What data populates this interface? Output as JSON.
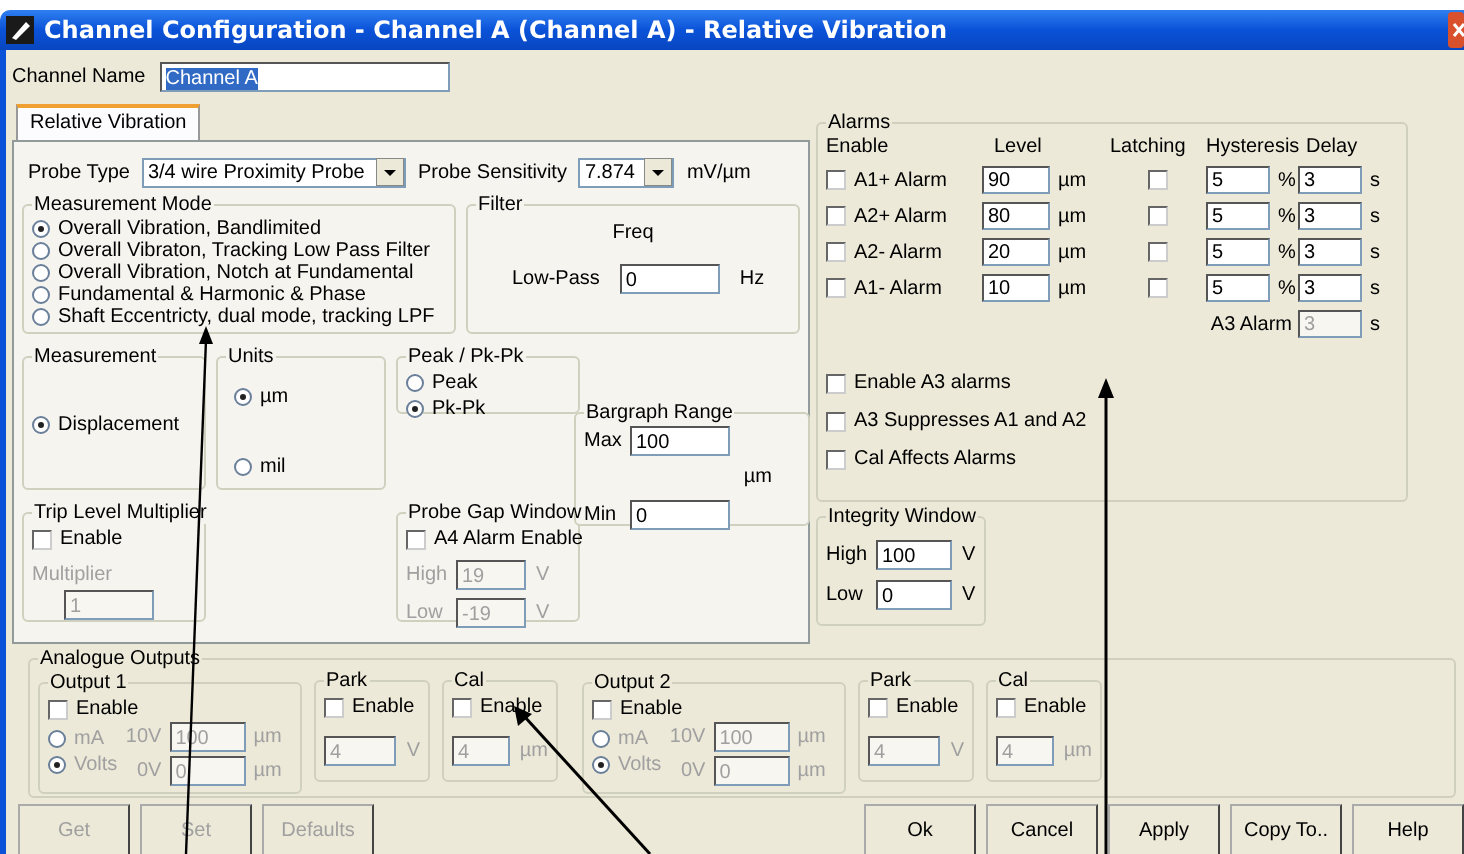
{
  "window": {
    "title": "Channel Configuration - Channel A (Channel A) - Relative Vibration"
  },
  "channel_name": {
    "label": "Channel Name",
    "value": "Channel A",
    "highlighted": true
  },
  "tabs": [
    {
      "label": "Relative Vibration",
      "selected": true
    }
  ],
  "probe_type": {
    "label": "Probe Type",
    "value": "3/4 wire Proximity Probe"
  },
  "probe_sensitivity": {
    "label": "Probe Sensitivity",
    "value": "7.874",
    "unit": "mV/µm"
  },
  "measurement_mode": {
    "title": "Measurement Mode",
    "options": [
      {
        "label": "Overall Vibration, Bandlimited",
        "selected": true
      },
      {
        "label": "Overall Vibraton, Tracking Low Pass Filter",
        "selected": false
      },
      {
        "label": "Overall Vibration, Notch at Fundamental",
        "selected": false
      },
      {
        "label": "Fundamental & Harmonic & Phase",
        "selected": false
      },
      {
        "label": "Shaft Eccentricty, dual mode, tracking LPF",
        "selected": false
      }
    ]
  },
  "filter": {
    "title": "Filter",
    "header": "Freq",
    "label": "Low-Pass",
    "value": "0",
    "unit": "Hz"
  },
  "measurement": {
    "title": "Measurement",
    "options": [
      {
        "label": "Displacement",
        "selected": true
      }
    ]
  },
  "units": {
    "title": "Units",
    "options": [
      {
        "label": "µm",
        "selected": true
      },
      {
        "label": "mil",
        "selected": false
      }
    ]
  },
  "peak": {
    "title": "Peak / Pk-Pk",
    "options": [
      {
        "label": "Peak",
        "selected": false
      },
      {
        "label": "Pk-Pk",
        "selected": true
      }
    ]
  },
  "bargraph": {
    "title": "Bargraph Range",
    "max_label": "Max",
    "max": "100",
    "unit": "µm",
    "min_label": "Min",
    "min": "0"
  },
  "trip_level": {
    "title": "Trip Level Multiplier",
    "enable": {
      "label": "Enable",
      "checked": false
    },
    "multiplier": {
      "label": "Multiplier",
      "value": "1",
      "disabled": true
    }
  },
  "probe_gap": {
    "title": "Probe Gap Window",
    "enable": {
      "label": "A4 Alarm Enable",
      "checked": false
    },
    "fields": [
      {
        "label": "High",
        "value": "19",
        "unit": "V",
        "disabled": true
      },
      {
        "label": "Low",
        "value": "-19",
        "unit": "V",
        "disabled": true
      }
    ]
  },
  "alarms": {
    "title": "Alarms",
    "headers": [
      "Enable",
      "Level",
      "Latching",
      "Hysteresis",
      "Delay"
    ],
    "rows": [
      {
        "name": "A1+ Alarm",
        "checked": false,
        "level": "90",
        "level_unit": "µm",
        "latching": false,
        "hysteresis": "5",
        "hysteresis_unit": "%",
        "delay": "3",
        "delay_unit": "s"
      },
      {
        "name": "A2+ Alarm",
        "checked": false,
        "level": "80",
        "level_unit": "µm",
        "latching": false,
        "hysteresis": "5",
        "hysteresis_unit": "%",
        "delay": "3",
        "delay_unit": "s"
      },
      {
        "name": "A2- Alarm",
        "checked": false,
        "level": "20",
        "level_unit": "µm",
        "latching": false,
        "hysteresis": "5",
        "hysteresis_unit": "%",
        "delay": "3",
        "delay_unit": "s"
      },
      {
        "name": "A1- Alarm",
        "checked": false,
        "level": "10",
        "level_unit": "µm",
        "latching": false,
        "hysteresis": "5",
        "hysteresis_unit": "%",
        "delay": "3",
        "delay_unit": "s"
      }
    ],
    "a3": {
      "label": "A3 Alarm",
      "value": "3",
      "unit": "s",
      "disabled": true
    },
    "options": [
      {
        "label": "Enable A3 alarms",
        "checked": false
      },
      {
        "label": "A3 Suppresses A1 and A2",
        "checked": false
      },
      {
        "label": "Cal Affects Alarms",
        "checked": false
      }
    ]
  },
  "integrity": {
    "title": "Integrity Window",
    "fields": [
      {
        "label": "High",
        "value": "100",
        "unit": "V",
        "disabled": false
      },
      {
        "label": "Low",
        "value": "0",
        "unit": "V",
        "disabled": false
      }
    ]
  },
  "analogue": {
    "title": "Analogue Outputs",
    "outputs": [
      {
        "title": "Output 1",
        "enable": {
          "label": "Enable",
          "checked": false
        },
        "modes": [
          {
            "label": "mA",
            "selected": false
          },
          {
            "label": "Volts",
            "selected": true
          }
        ],
        "rows": [
          {
            "label": "10V",
            "value": "100",
            "unit": "µm"
          },
          {
            "label": "0V",
            "value": "0",
            "unit": "µm"
          }
        ],
        "park": {
          "title": "Park",
          "enable": {
            "label": "Enable",
            "checked": false
          },
          "value": "4",
          "unit": "V"
        },
        "cal": {
          "title": "Cal",
          "enable": {
            "label": "Enable",
            "checked": false
          },
          "value": "4",
          "unit": "µm"
        }
      },
      {
        "title": "Output 2",
        "enable": {
          "label": "Enable",
          "checked": false
        },
        "modes": [
          {
            "label": "mA",
            "selected": false
          },
          {
            "label": "Volts",
            "selected": true
          }
        ],
        "rows": [
          {
            "label": "10V",
            "value": "100",
            "unit": "µm"
          },
          {
            "label": "0V",
            "value": "0",
            "unit": "µm"
          }
        ],
        "park": {
          "title": "Park",
          "enable": {
            "label": "Enable",
            "checked": false
          },
          "value": "4",
          "unit": "V"
        },
        "cal": {
          "title": "Cal",
          "enable": {
            "label": "Enable",
            "checked": false
          },
          "value": "4",
          "unit": "µm"
        }
      }
    ]
  },
  "buttons_left": [
    {
      "label": "Get",
      "disabled": true
    },
    {
      "label": "Set",
      "disabled": true
    },
    {
      "label": "Defaults",
      "disabled": true
    }
  ],
  "buttons_right": [
    {
      "label": "Ok",
      "disabled": false
    },
    {
      "label": "Cancel",
      "disabled": false
    },
    {
      "label": "Apply",
      "disabled": false
    },
    {
      "label": "Copy To..",
      "disabled": false
    },
    {
      "label": "Help",
      "disabled": false
    }
  ]
}
